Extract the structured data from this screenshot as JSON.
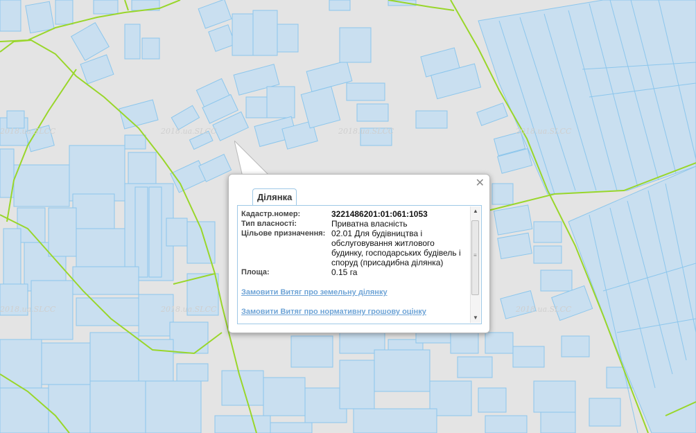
{
  "map": {
    "watermark": "2018.ua.SLCC",
    "colors": {
      "background": "#e4e4e4",
      "parcel_fill": "#c9dff0",
      "parcel_stroke": "#8cc6ec",
      "boundary": "#99d62a"
    }
  },
  "popup": {
    "close_icon": "close-icon",
    "tab_label": "Ділянка",
    "fields": [
      {
        "label": "Кадастр.номер:",
        "value": "3221486201:01:061:1053"
      },
      {
        "label": "Тип власності:",
        "value": "Приватна власність"
      },
      {
        "label": "Цільове призначення:",
        "value": "02.01 Для будівництва і обслуговування житлового будинку, господарських будівель і споруд (присадибна ділянка)"
      },
      {
        "label": "Площа:",
        "value": "0.15 га"
      }
    ],
    "links": [
      "Замовити Витяг про земельну ділянку",
      "Замовити Витяг про нормативну грошову оцінку"
    ]
  }
}
